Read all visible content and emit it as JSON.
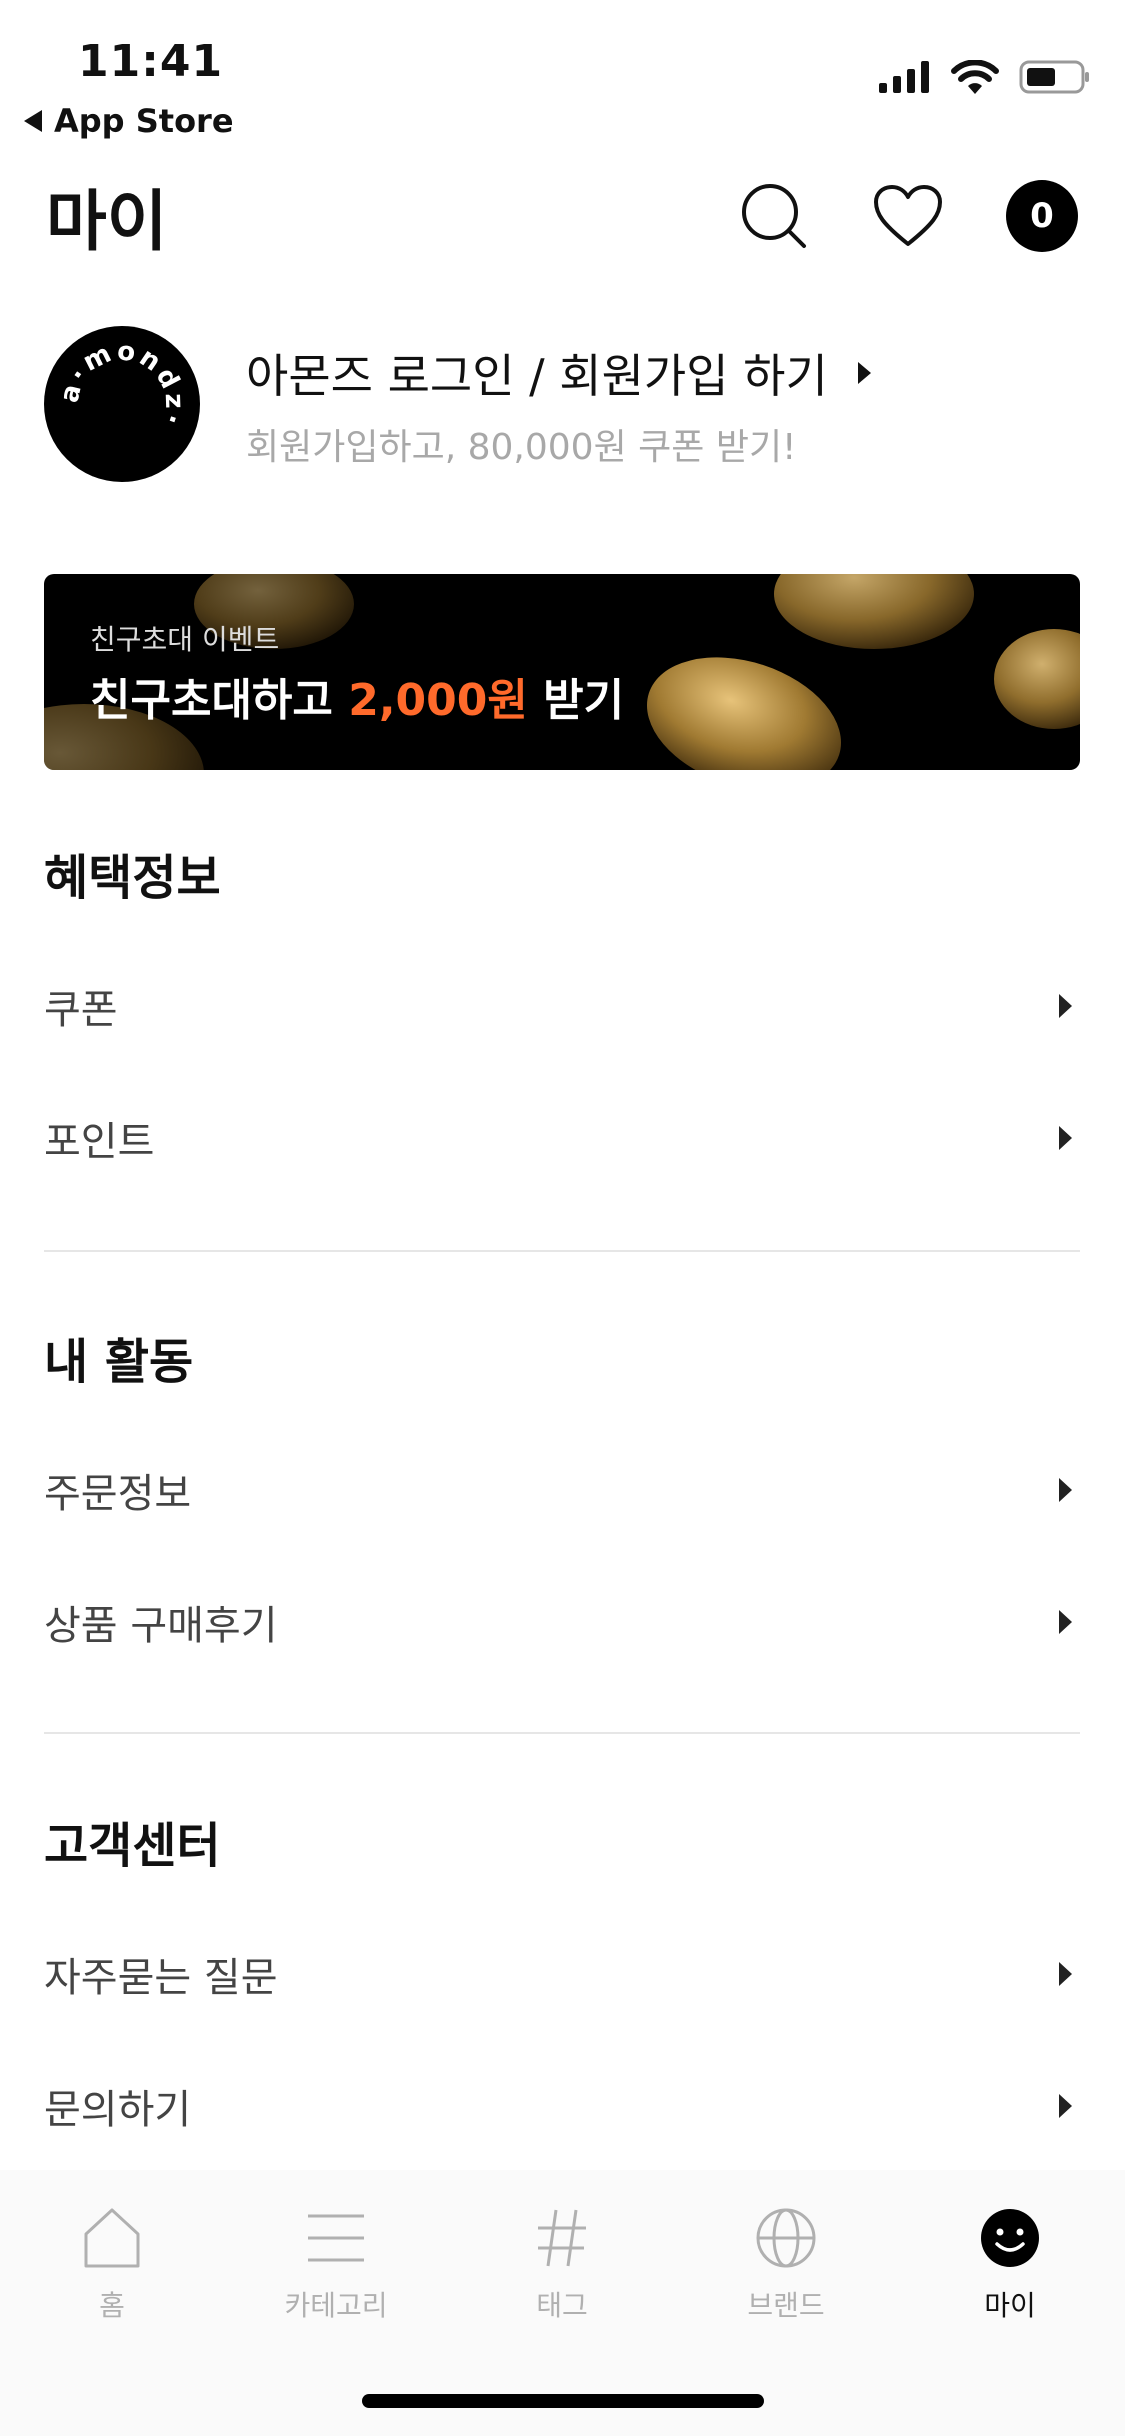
{
  "status": {
    "time": "11:41",
    "back_label": "App Store"
  },
  "header": {
    "title": "마이",
    "search_icon": "search-icon",
    "wishlist_icon": "heart-icon",
    "cart_count": "0"
  },
  "profile": {
    "logo_text": "a·mondz·",
    "title": "아몬즈 로그인 / 회원가입 하기",
    "subtitle": "회원가입하고, 80,000원 쿠폰 받기!"
  },
  "banner": {
    "subtitle": "친구초대 이벤트",
    "title_prefix": "친구초대하고 ",
    "title_accent": "2,000원",
    "title_suffix": " 받기",
    "accent_color": "#ff6a2b"
  },
  "sections": {
    "benefits": {
      "title": "혜택정보",
      "items": [
        "쿠폰",
        "포인트"
      ]
    },
    "activity": {
      "title": "내 활동",
      "items": [
        "주문정보",
        "상품 구매후기"
      ]
    },
    "support": {
      "title": "고객센터",
      "items": [
        "자주묻는 질문",
        "문의하기"
      ]
    }
  },
  "tabbar": {
    "tabs": [
      {
        "label": "홈",
        "icon": "home-icon"
      },
      {
        "label": "카테고리",
        "icon": "menu-icon"
      },
      {
        "label": "태그",
        "icon": "hashtag-icon"
      },
      {
        "label": "브랜드",
        "icon": "globe-icon"
      },
      {
        "label": "마이",
        "icon": "smiley-icon"
      }
    ],
    "active": "마이"
  }
}
